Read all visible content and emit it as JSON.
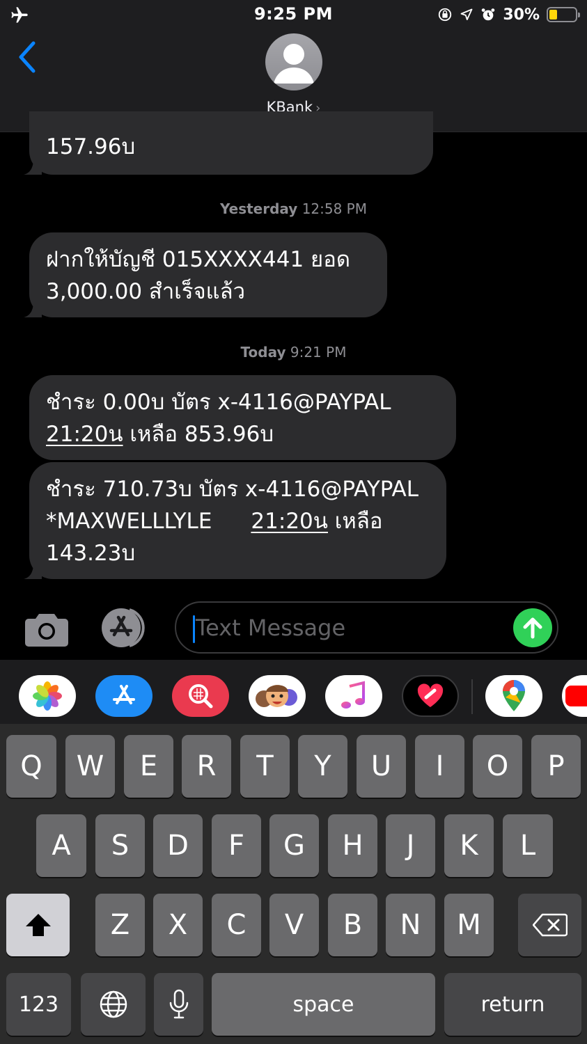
{
  "status_bar": {
    "time": "9:25 PM",
    "battery_percent": "30%",
    "battery_level": 0.3,
    "icons": [
      "airplane-icon",
      "orientation-lock-icon",
      "location-icon",
      "alarm-icon",
      "battery-icon"
    ]
  },
  "header": {
    "contact_name": "KBank",
    "chevron": "›"
  },
  "messages": [
    {
      "lines": [
        "157.96บ"
      ]
    },
    {
      "timestamp": {
        "day": "Yesterday",
        "time": "12:58 PM"
      }
    },
    {
      "lines": [
        "ฝากให้บัญชี 015XXXX441 ยอด",
        "3,000.00 สำเร็จแล้ว"
      ]
    },
    {
      "timestamp": {
        "day": "Today",
        "time": "9:21 PM"
      }
    },
    {
      "line1": "ชำระ 0.00บ บัตร x-4116@PAYPAL",
      "line2_time": "21:20น",
      "line2_rest": " เหลือ 853.96บ"
    },
    {
      "line1": "ชำระ 710.73บ บัตร x-4116@PAYPAL",
      "line2_merchant": "*MAXWELLLYLE",
      "line2_time": "21:20น",
      "line2_rest": " เหลือ",
      "line3": "143.23บ"
    }
  ],
  "input": {
    "placeholder": "Text Message"
  },
  "app_drawer": [
    "photos-icon",
    "app-store-icon",
    "web-images-icon",
    "memoji-icon",
    "music-icon",
    "digital-touch-icon",
    "maps-icon",
    "youtube-icon"
  ],
  "keyboard": {
    "row1": [
      "Q",
      "W",
      "E",
      "R",
      "T",
      "Y",
      "U",
      "I",
      "O",
      "P"
    ],
    "row2": [
      "A",
      "S",
      "D",
      "F",
      "G",
      "H",
      "J",
      "K",
      "L"
    ],
    "row3": [
      "Z",
      "X",
      "C",
      "V",
      "B",
      "N",
      "M"
    ],
    "numbers_label": "123",
    "space_label": "space",
    "return_label": "return"
  },
  "colors": {
    "accent": "#0a84ff",
    "bubble": "#2c2c2e",
    "send": "#30d158"
  }
}
